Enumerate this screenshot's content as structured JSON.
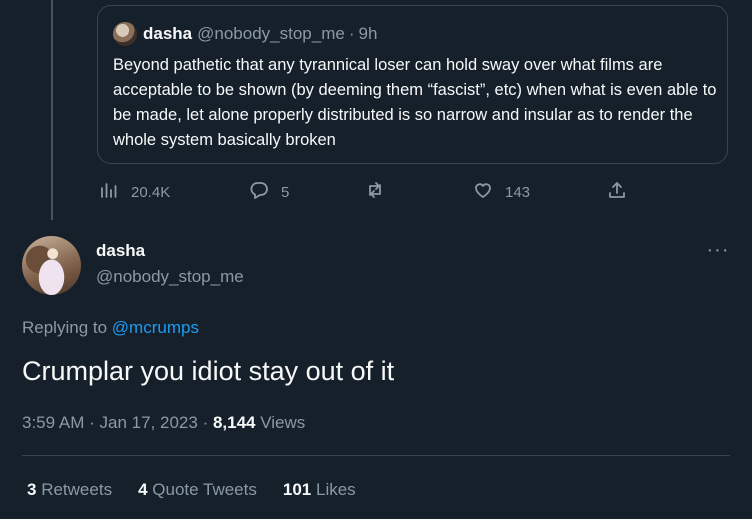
{
  "quoted_tweet": {
    "author_name": "dasha",
    "author_handle": "@nobody_stop_me",
    "separator": "·",
    "time": "9h",
    "text": "Beyond pathetic that any tyrannical loser can hold sway over what films are acceptable to be shown (by deeming them “fascist”, etc) when what is even able to be made, let alone properly distributed is so narrow and insular as to render the whole system basically broken"
  },
  "actions": {
    "views": "20.4K",
    "replies": "5",
    "retweets": "",
    "likes": "143"
  },
  "tweet": {
    "author_name": "dasha",
    "author_handle": "@nobody_stop_me",
    "replying_prefix": "Replying to",
    "replying_to": "@mcrumps",
    "text": "Crumplar you idiot stay out of it",
    "time": "3:59 AM",
    "date_sep": "·",
    "date": "Jan 17, 2023",
    "views_sep": "·",
    "views_count": "8,144",
    "views_label": "Views",
    "more_label": "···"
  },
  "stats": {
    "retweets_count": "3",
    "retweets_label": "Retweets",
    "quote_count": "4",
    "quote_label": "Quote Tweets",
    "likes_count": "101",
    "likes_label": "Likes"
  },
  "icons": [
    "analytics-icon",
    "reply-icon",
    "retweet-icon",
    "like-icon",
    "share-icon",
    "more-icon"
  ],
  "colors": {
    "background": "#15202b",
    "accent": "#1d9bf0",
    "muted": "#8b98a5",
    "text": "#f7f9f9"
  }
}
